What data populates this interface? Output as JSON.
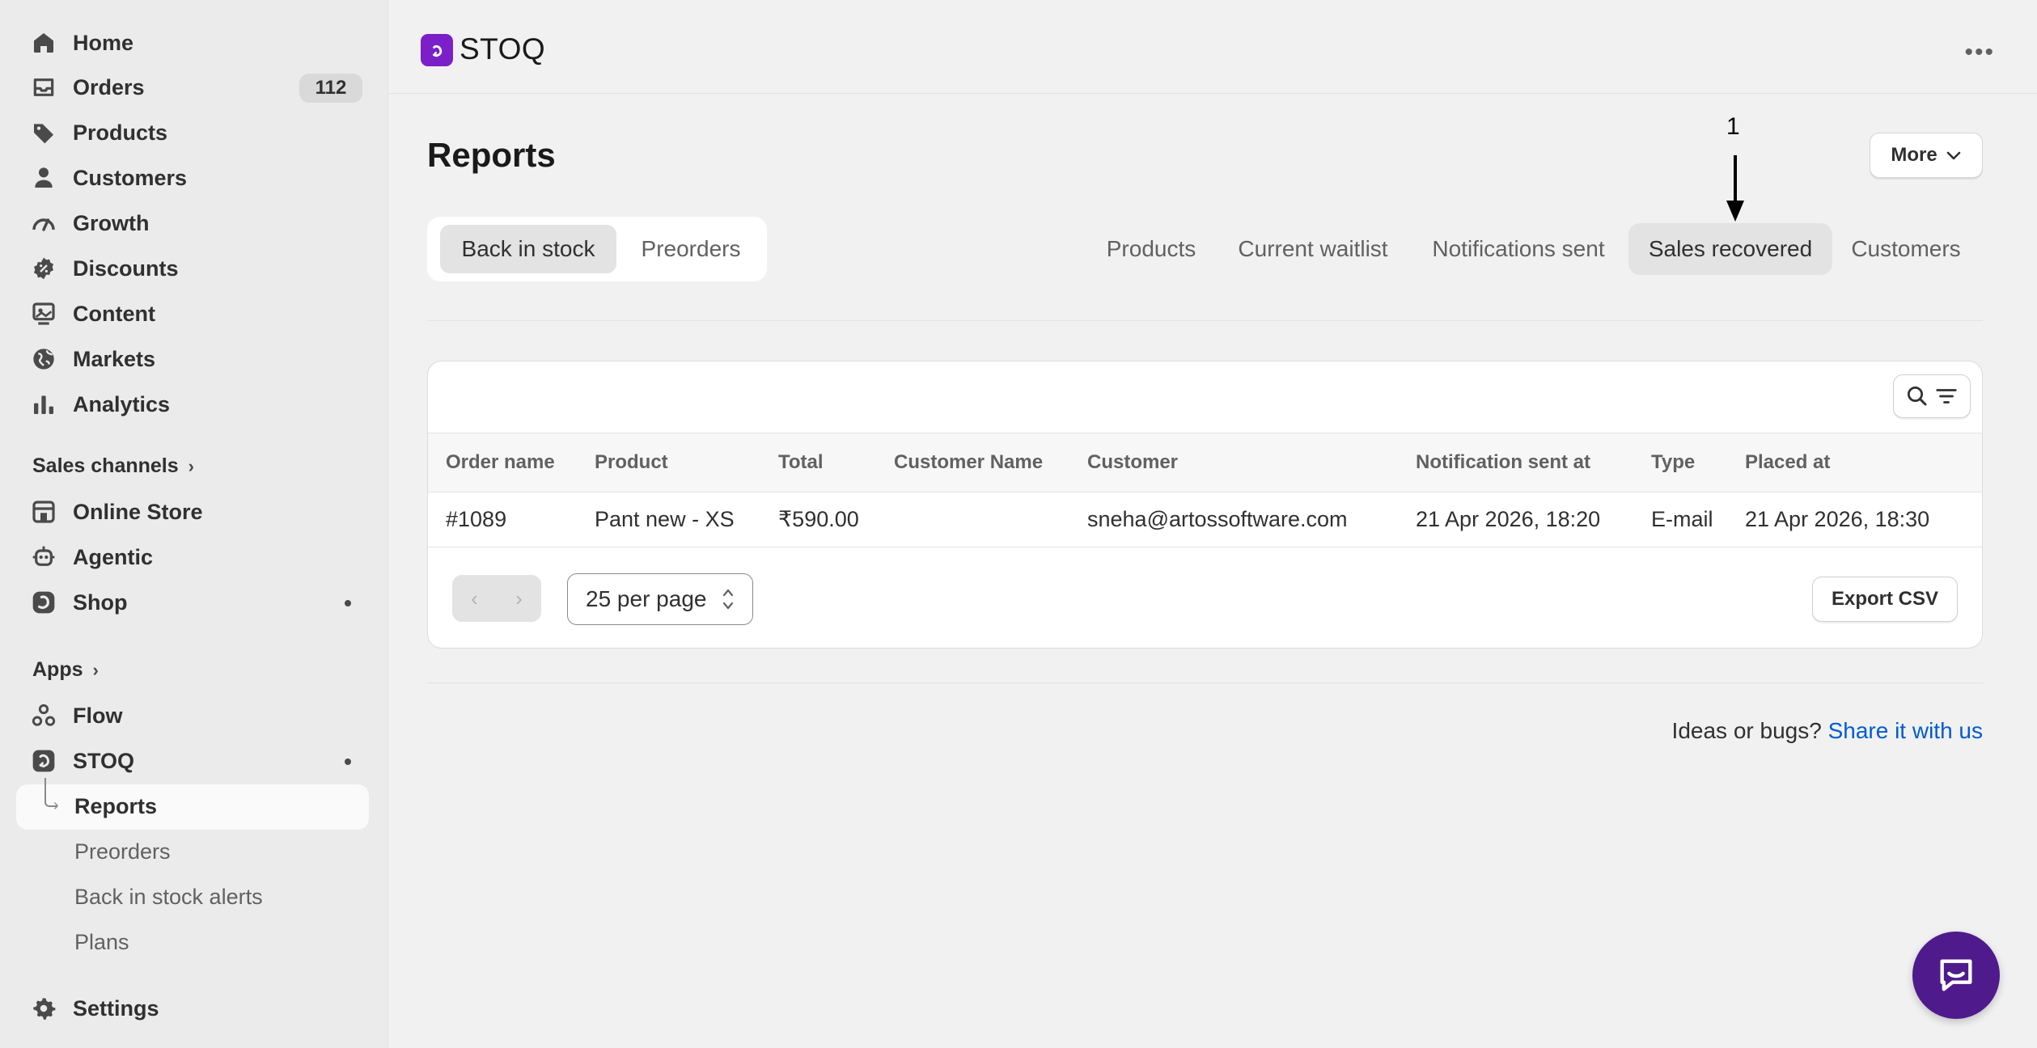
{
  "sidebar": {
    "items": [
      {
        "label": "Home",
        "icon": "home-icon"
      },
      {
        "label": "Orders",
        "icon": "inbox-icon",
        "badge": "112"
      },
      {
        "label": "Products",
        "icon": "tag-icon"
      },
      {
        "label": "Customers",
        "icon": "person-icon"
      },
      {
        "label": "Growth",
        "icon": "gauge-icon"
      },
      {
        "label": "Discounts",
        "icon": "discount-icon"
      },
      {
        "label": "Content",
        "icon": "content-icon"
      },
      {
        "label": "Markets",
        "icon": "globe-icon"
      },
      {
        "label": "Analytics",
        "icon": "bar-chart-icon"
      }
    ],
    "sales_channels_title": "Sales channels",
    "channels": [
      {
        "label": "Online Store",
        "icon": "store-icon"
      },
      {
        "label": "Agentic",
        "icon": "agentic-icon"
      },
      {
        "label": "Shop",
        "icon": "shop-icon"
      }
    ],
    "apps_title": "Apps",
    "apps": [
      {
        "label": "Flow",
        "icon": "flow-icon"
      },
      {
        "label": "STOQ",
        "icon": "stoq-icon"
      }
    ],
    "stoq_sub": [
      "Reports",
      "Preorders",
      "Back in stock alerts",
      "Plans"
    ],
    "settings": "Settings"
  },
  "header": {
    "app_title": "STOQ",
    "more_icon": "kebab-icon"
  },
  "page": {
    "title": "Reports",
    "more_button": "More",
    "annotation": "1",
    "segment": {
      "options": [
        "Back in stock",
        "Preorders"
      ],
      "selected": "Back in stock"
    },
    "tabs": [
      "Products",
      "Current waitlist",
      "Notifications sent",
      "Sales recovered",
      "Customers"
    ],
    "active_tab": "Sales recovered"
  },
  "table": {
    "columns": [
      "Order name",
      "Product",
      "Total",
      "Customer Name",
      "Customer",
      "Notification sent at",
      "Type",
      "Placed at"
    ],
    "rows": [
      [
        "#1089",
        "Pant new - XS",
        "₹590.00",
        "",
        "sneha@artossoftware.com",
        "21 Apr 2026, 18:20",
        "E-mail",
        "21 Apr 2026, 18:30"
      ]
    ],
    "per_page": "25 per page",
    "export": "Export CSV"
  },
  "footer": {
    "feedback_text": "Ideas or bugs?",
    "feedback_link": "Share it with us"
  },
  "colors": {
    "accent": "#7b1fc8",
    "chat": "#4f1b8c",
    "link": "#005bd3"
  }
}
